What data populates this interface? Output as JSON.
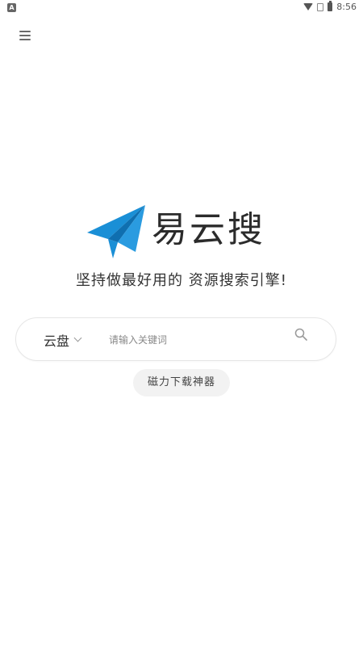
{
  "status_bar": {
    "time": "8:56",
    "left_icon": "A",
    "icons": [
      "wifi-icon",
      "sim-icon",
      "battery-icon"
    ]
  },
  "header": {
    "menu_icon": "hamburger-icon"
  },
  "logo": {
    "text": "易云搜",
    "icon": "paper-plane-icon",
    "brand_color": "#1a8fd6"
  },
  "slogan": "坚持做最好用的 资源搜索引擎!",
  "search": {
    "type_selected": "云盘",
    "placeholder": "请输入关键词",
    "value": ""
  },
  "magnet_button": {
    "label": "磁力下载神器"
  }
}
